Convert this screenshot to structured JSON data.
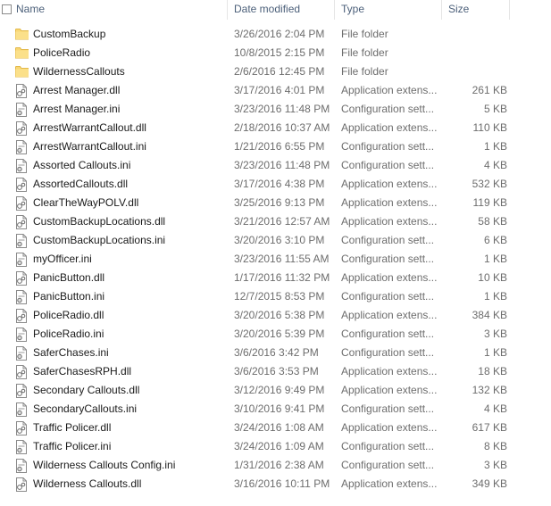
{
  "columns": {
    "name": "Name",
    "date_modified": "Date modified",
    "type": "Type",
    "size": "Size"
  },
  "files": [
    {
      "name": "CustomBackup",
      "date": "3/26/2016 2:04 PM",
      "type": "File folder",
      "size": "",
      "icon": "folder-icon"
    },
    {
      "name": "PoliceRadio",
      "date": "10/8/2015 2:15 PM",
      "type": "File folder",
      "size": "",
      "icon": "folder-icon"
    },
    {
      "name": "WildernessCallouts",
      "date": "2/6/2016 12:45 PM",
      "type": "File folder",
      "size": "",
      "icon": "folder-icon"
    },
    {
      "name": "Arrest Manager.dll",
      "date": "3/17/2016 4:01 PM",
      "type": "Application extens...",
      "size": "261 KB",
      "icon": "dll-file-icon"
    },
    {
      "name": "Arrest Manager.ini",
      "date": "3/23/2016 11:48 PM",
      "type": "Configuration sett...",
      "size": "5 KB",
      "icon": "ini-file-icon"
    },
    {
      "name": "ArrestWarrantCallout.dll",
      "date": "2/18/2016 10:37 AM",
      "type": "Application extens...",
      "size": "110 KB",
      "icon": "dll-file-icon"
    },
    {
      "name": "ArrestWarrantCallout.ini",
      "date": "1/21/2016 6:55 PM",
      "type": "Configuration sett...",
      "size": "1 KB",
      "icon": "ini-file-icon"
    },
    {
      "name": "Assorted Callouts.ini",
      "date": "3/23/2016 11:48 PM",
      "type": "Configuration sett...",
      "size": "4 KB",
      "icon": "ini-file-icon"
    },
    {
      "name": "AssortedCallouts.dll",
      "date": "3/17/2016 4:38 PM",
      "type": "Application extens...",
      "size": "532 KB",
      "icon": "dll-file-icon"
    },
    {
      "name": "ClearTheWayPOLV.dll",
      "date": "3/25/2016 9:13 PM",
      "type": "Application extens...",
      "size": "119 KB",
      "icon": "dll-file-icon"
    },
    {
      "name": "CustomBackupLocations.dll",
      "date": "3/21/2016 12:57 AM",
      "type": "Application extens...",
      "size": "58 KB",
      "icon": "dll-file-icon"
    },
    {
      "name": "CustomBackupLocations.ini",
      "date": "3/20/2016 3:10 PM",
      "type": "Configuration sett...",
      "size": "6 KB",
      "icon": "ini-file-icon"
    },
    {
      "name": "myOfficer.ini",
      "date": "3/23/2016 11:55 AM",
      "type": "Configuration sett...",
      "size": "1 KB",
      "icon": "ini-file-icon"
    },
    {
      "name": "PanicButton.dll",
      "date": "1/17/2016 11:32 PM",
      "type": "Application extens...",
      "size": "10 KB",
      "icon": "dll-file-icon"
    },
    {
      "name": "PanicButton.ini",
      "date": "12/7/2015 8:53 PM",
      "type": "Configuration sett...",
      "size": "1 KB",
      "icon": "ini-file-icon"
    },
    {
      "name": "PoliceRadio.dll",
      "date": "3/20/2016 5:38 PM",
      "type": "Application extens...",
      "size": "384 KB",
      "icon": "dll-file-icon"
    },
    {
      "name": "PoliceRadio.ini",
      "date": "3/20/2016 5:39 PM",
      "type": "Configuration sett...",
      "size": "3 KB",
      "icon": "ini-file-icon"
    },
    {
      "name": "SaferChases.ini",
      "date": "3/6/2016 3:42 PM",
      "type": "Configuration sett...",
      "size": "1 KB",
      "icon": "ini-file-icon"
    },
    {
      "name": "SaferChasesRPH.dll",
      "date": "3/6/2016 3:53 PM",
      "type": "Application extens...",
      "size": "18 KB",
      "icon": "dll-file-icon"
    },
    {
      "name": "Secondary Callouts.dll",
      "date": "3/12/2016 9:49 PM",
      "type": "Application extens...",
      "size": "132 KB",
      "icon": "dll-file-icon"
    },
    {
      "name": "SecondaryCallouts.ini",
      "date": "3/10/2016 9:41 PM",
      "type": "Configuration sett...",
      "size": "4 KB",
      "icon": "ini-file-icon"
    },
    {
      "name": "Traffic Policer.dll",
      "date": "3/24/2016 1:08 AM",
      "type": "Application extens...",
      "size": "617 KB",
      "icon": "dll-file-icon"
    },
    {
      "name": "Traffic Policer.ini",
      "date": "3/24/2016 1:09 AM",
      "type": "Configuration sett...",
      "size": "8 KB",
      "icon": "ini-file-icon"
    },
    {
      "name": "Wilderness Callouts Config.ini",
      "date": "1/31/2016 2:38 AM",
      "type": "Configuration sett...",
      "size": "3 KB",
      "icon": "ini-file-icon"
    },
    {
      "name": "Wilderness Callouts.dll",
      "date": "3/16/2016 10:11 PM",
      "type": "Application extens...",
      "size": "349 KB",
      "icon": "dll-file-icon"
    }
  ],
  "colors": {
    "header_text": "#4c607a",
    "folder": "#f8d775",
    "detail_text": "#6d6d6d"
  }
}
